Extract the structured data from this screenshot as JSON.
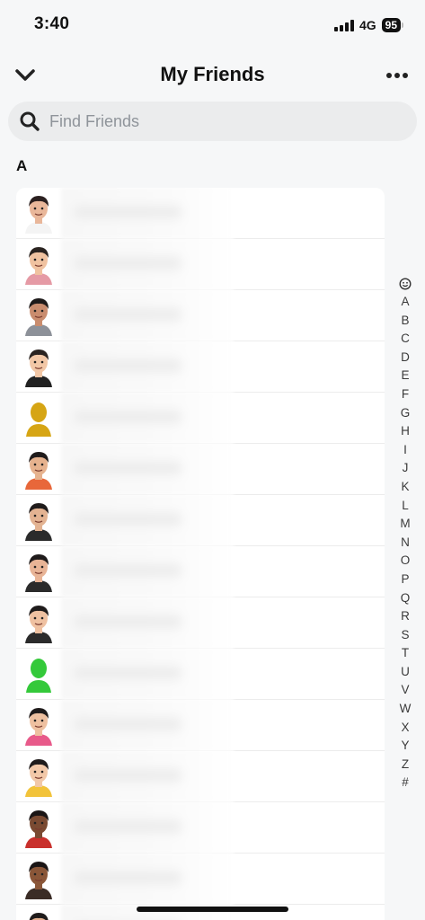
{
  "status_bar": {
    "time": "3:40",
    "network": "4G",
    "battery": "95"
  },
  "header": {
    "title": "My Friends"
  },
  "search": {
    "placeholder": "Find Friends"
  },
  "section": {
    "letter": "A"
  },
  "friends": [
    {
      "avatar": "female-glasses-avatar-icon",
      "skin": "#e9b79a",
      "hair": "#2b2020",
      "shirt": "#f4f4f4"
    },
    {
      "avatar": "male-beard-avatar-icon",
      "skin": "#f0c2a0",
      "hair": "#2a2320",
      "shirt": "#e59aa5"
    },
    {
      "avatar": "female-long-hair-avatar-icon",
      "skin": "#c98c6e",
      "hair": "#1e1a1a",
      "shirt": "#8d9199"
    },
    {
      "avatar": "male-suit-avatar-icon",
      "skin": "#f2c7a6",
      "hair": "#2a2320",
      "shirt": "#222222"
    },
    {
      "avatar": "default-silhouette-avatar-icon",
      "skin": "#d6a514",
      "hair": "#d6a514",
      "shirt": "#d6a514"
    },
    {
      "avatar": "male-sunglasses-avatar-icon",
      "skin": "#e6b28e",
      "hair": "#1f1b1b",
      "shirt": "#e8673a"
    },
    {
      "avatar": "female-curly-glasses-avatar-icon",
      "skin": "#e3b392",
      "hair": "#1f1b1b",
      "shirt": "#2b2b2b"
    },
    {
      "avatar": "female-hearts-avatar-icon",
      "skin": "#e8b496",
      "hair": "#1f1b1b",
      "shirt": "#2b2b2b"
    },
    {
      "avatar": "male-glasses-avatar-icon",
      "skin": "#efc1a1",
      "hair": "#1f1b1b",
      "shirt": "#2b2b2b"
    },
    {
      "avatar": "green-silhouette-avatar-icon",
      "skin": "#34c93a",
      "hair": "#34c93a",
      "shirt": "#34c93a"
    },
    {
      "avatar": "male-flower-crown-avatar-icon",
      "skin": "#eec0a0",
      "hair": "#1f1b1b",
      "shirt": "#e85a8a"
    },
    {
      "avatar": "male-bun-avatar-icon",
      "skin": "#f2c8a8",
      "hair": "#1f1b1b",
      "shirt": "#f2c33a"
    },
    {
      "avatar": "male-dark-skin-avatar-icon",
      "skin": "#7a4a32",
      "hair": "#1a1515",
      "shirt": "#c9302c"
    },
    {
      "avatar": "male-dark-beard-avatar-icon",
      "skin": "#8a5638",
      "hair": "#1a1515",
      "shirt": "#3a2c26"
    },
    {
      "avatar": "male-partial-avatar-icon",
      "skin": "#e6b290",
      "hair": "#1f1b1b",
      "shirt": "#2b2b2b"
    }
  ],
  "alphabet_index": [
    "A",
    "B",
    "C",
    "D",
    "E",
    "F",
    "G",
    "H",
    "I",
    "J",
    "K",
    "L",
    "M",
    "N",
    "O",
    "P",
    "Q",
    "R",
    "S",
    "T",
    "U",
    "V",
    "W",
    "X",
    "Y",
    "Z",
    "#"
  ]
}
